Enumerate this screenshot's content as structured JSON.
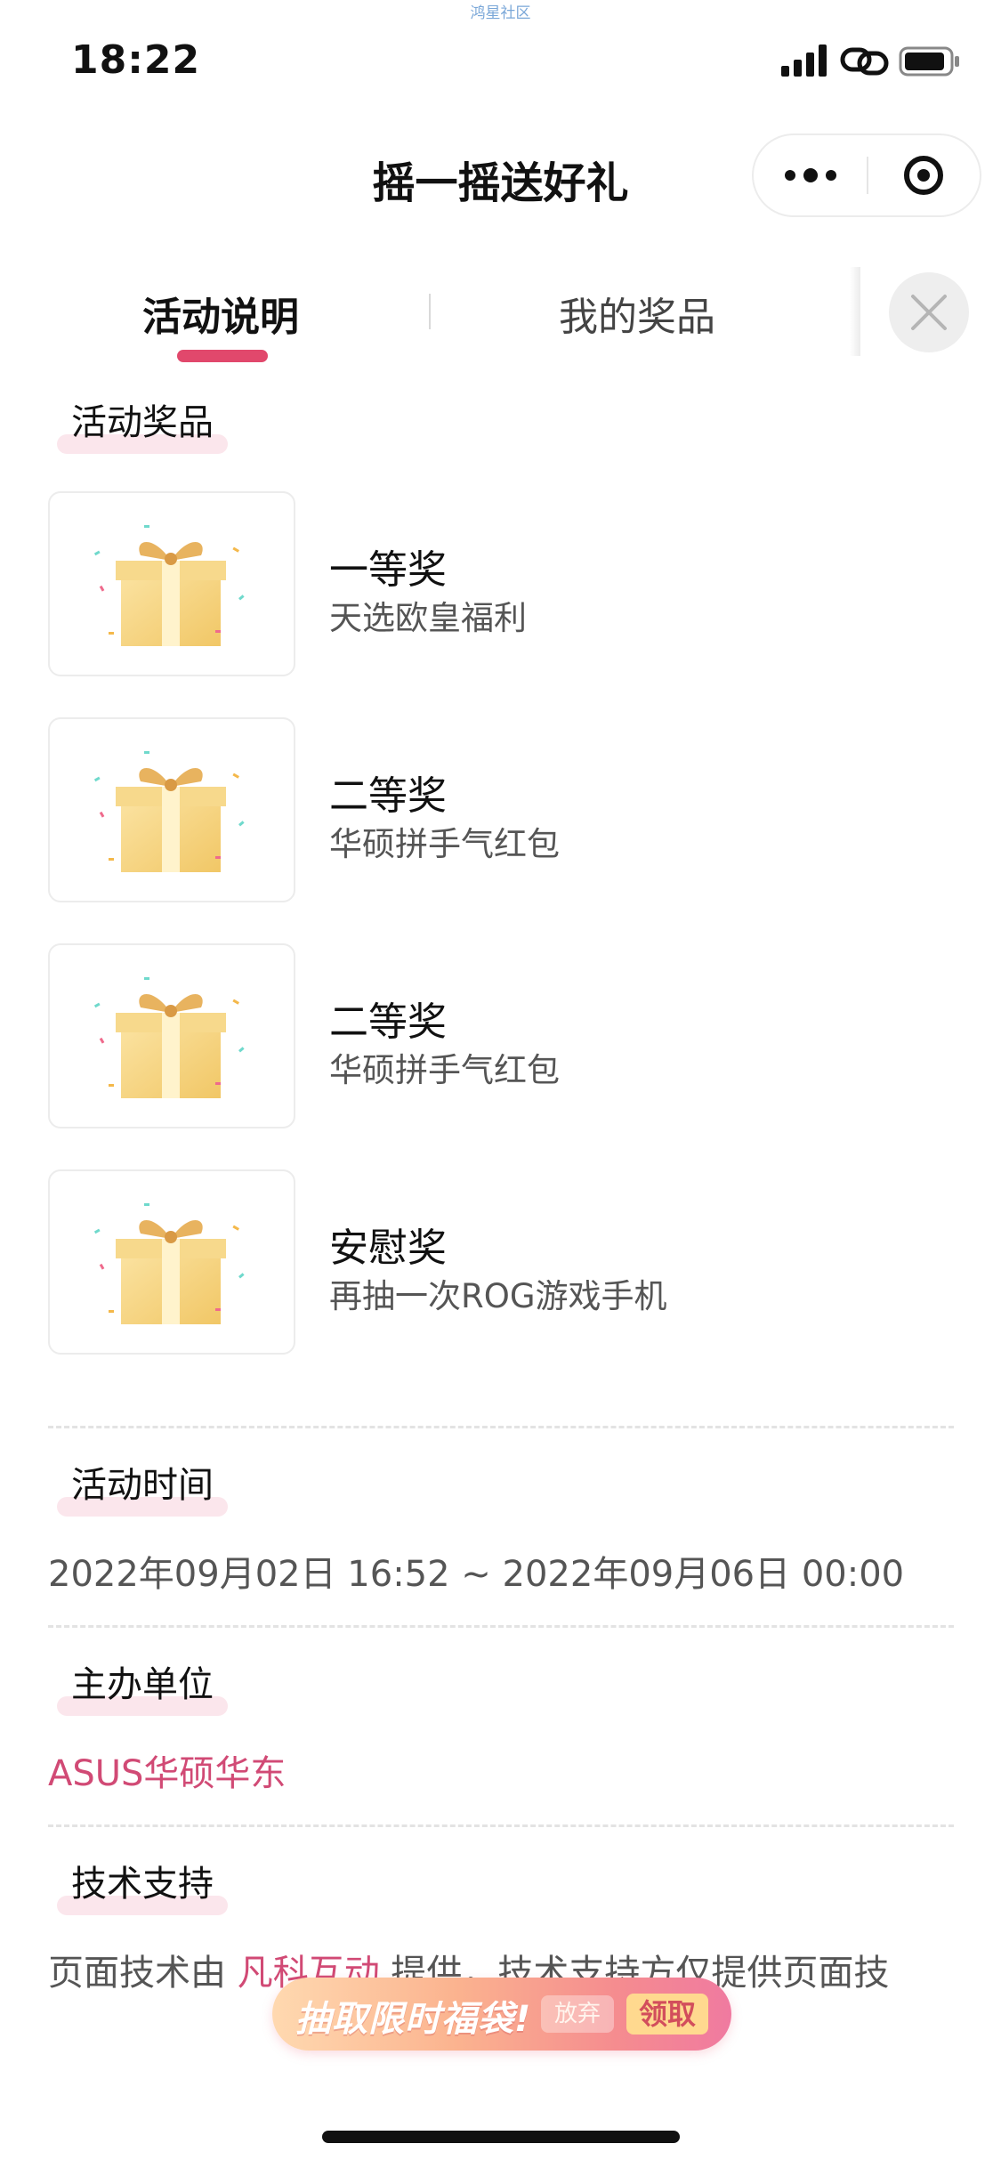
{
  "status_bar": {
    "top_watermark": "鸿星社区",
    "time": "18:22"
  },
  "title_bar": {
    "title": "摇一摇送好礼"
  },
  "tabs": [
    {
      "label": "活动说明",
      "active": true
    },
    {
      "label": "我的奖品",
      "active": false
    }
  ],
  "accent_color": "#e1486c",
  "prizes_section": {
    "heading": "活动奖品",
    "items": [
      {
        "title": "一等奖",
        "desc": "天选欧皇福利",
        "icon": "gift-box-icon"
      },
      {
        "title": "二等奖",
        "desc": "华硕拼手气红包",
        "icon": "gift-box-icon"
      },
      {
        "title": "二等奖",
        "desc": "华硕拼手气红包",
        "icon": "gift-box-icon"
      },
      {
        "title": "安慰奖",
        "desc": "再抽一次ROG游戏手机",
        "icon": "gift-box-icon"
      }
    ]
  },
  "time_section": {
    "heading": "活动时间",
    "value": "2022年09月02日 16:52 ~ 2022年09月06日 00:00"
  },
  "organizer_section": {
    "heading": "主办单位",
    "value": "ASUS华硕华东"
  },
  "tech_section": {
    "heading": "技术支持",
    "text_before": "页面技术由 ",
    "link": "凡科互动",
    "text_after": " 提供，技术支持方仅提供页面技"
  },
  "banner": {
    "text": "抽取限时福袋!",
    "giveup_label": "放弃",
    "claim_label": "领取"
  }
}
